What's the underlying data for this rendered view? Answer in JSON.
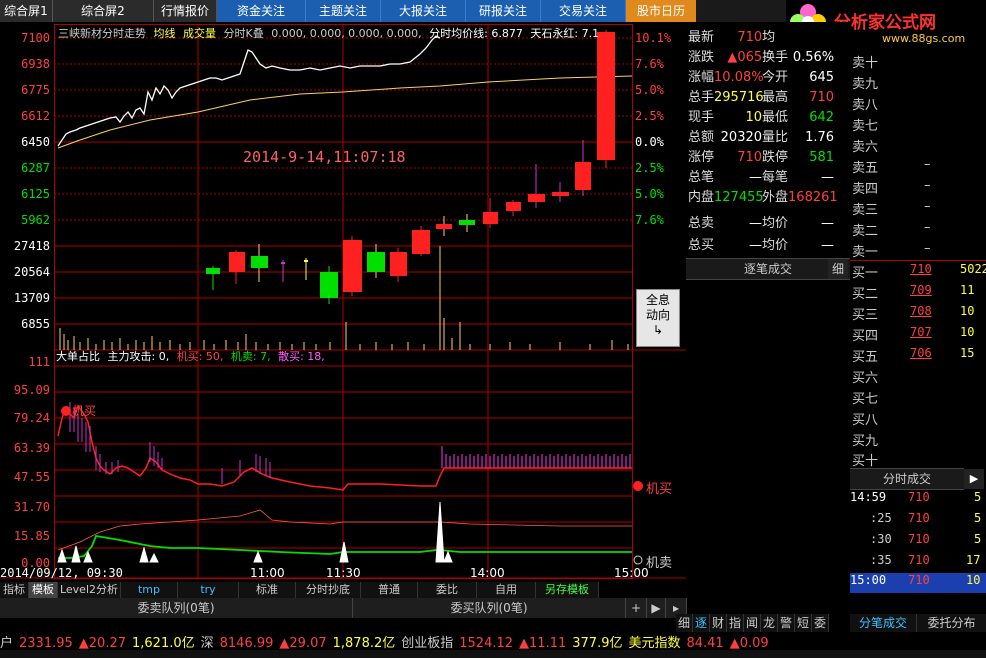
{
  "top_tabs": [
    {
      "label": "综合屏1",
      "style": "dark"
    },
    {
      "label": "综合屏2",
      "style": "dark"
    },
    {
      "label": "行情报价",
      "style": "dark"
    },
    {
      "label": "资金关注",
      "style": "blue"
    },
    {
      "label": "主题关注",
      "style": "blue"
    },
    {
      "label": "大报关注",
      "style": "blue"
    },
    {
      "label": "研报关注",
      "style": "blue"
    },
    {
      "label": "交易关注",
      "style": "blue"
    },
    {
      "label": "股市日历",
      "style": "orange"
    }
  ],
  "logo": {
    "text": "分析家公式网",
    "url_text": "www.88gs.com"
  },
  "chart_header": {
    "title": "三峡新材分时走势",
    "items": [
      "均线",
      "成交量",
      "分时K叠",
      "0.000, 0.000, 0.000, 0.000,",
      "分时均价线: 6.877",
      "天石永红: 7.1"
    ]
  },
  "date_stamp": "2014-9-14,11:07:18",
  "info_button": {
    "line1": "全息",
    "line2": "动向"
  },
  "lower_header": {
    "title": "大单占比",
    "main_attack": "主力攻击: 0,",
    "inst_buy": "机买: 50,",
    "inst_sell": "机卖: 7,",
    "retail_sell": "散买: 18,"
  },
  "lower_markers": {
    "buy_label": "机买",
    "sell_label": "机卖",
    "top_label": "机买"
  },
  "price_axis_left": [
    "7100",
    "6938",
    "6775",
    "6612",
    "6450",
    "6287",
    "6125",
    "5962"
  ],
  "pct_axis_right": [
    "10.1%",
    "7.6%",
    "5.0%",
    "2.5%",
    "0.0%",
    "2.5%",
    "5.0%",
    "7.6%"
  ],
  "volume_axis": [
    "27418",
    "20564",
    "13709",
    "6855"
  ],
  "lower_axis": [
    "111",
    "95.09",
    "79.24",
    "63.39",
    "47.55",
    "31.70",
    "15.85",
    "0.00"
  ],
  "time_axis": {
    "date": "2014/09/12, 09:30",
    "t1": "11:00",
    "t2": "11:30",
    "t3": "14:00",
    "t4": "15:00"
  },
  "quote": {
    "rows": [
      {
        "l": "最新",
        "v1": "710",
        "l2": "均",
        "v2": "",
        "c1": "qred",
        "c2": "qred"
      },
      {
        "l": "涨跌",
        "v1": "▲065",
        "l2": "换手",
        "v2": "0.56%",
        "c1": "qred",
        "c2": "qwht"
      },
      {
        "l": "涨幅",
        "v1": "10.08%",
        "l2": "今开",
        "v2": "645",
        "c1": "qred",
        "c2": "qwht"
      },
      {
        "l": "总手",
        "v1": "295716",
        "l2": "最高",
        "v2": "710",
        "c1": "qyel",
        "c2": "qred"
      },
      {
        "l": "现手",
        "v1": "10",
        "l2": "最低",
        "v2": "642",
        "c1": "qyel",
        "c2": "qgrn"
      },
      {
        "l": "总额",
        "v1": "20320",
        "l2": "量比",
        "v2": "1.76",
        "c1": "qwht",
        "c2": "qwht"
      },
      {
        "l": "涨停",
        "v1": "710",
        "l2": "跌停",
        "v2": "581",
        "c1": "qred",
        "c2": "qgrn"
      },
      {
        "l": "总笔",
        "v1": "—",
        "l2": "每笔",
        "v2": "—",
        "c1": "qwht",
        "c2": "qwht"
      },
      {
        "l": "内盘",
        "v1": "127455",
        "l2": "外盘",
        "v2": "168261",
        "c1": "qgrn",
        "c2": "qred"
      },
      {
        "l": "总卖",
        "v1": "—",
        "l2": "均价",
        "v2": "—",
        "c1": "qwht",
        "c2": "qwht"
      },
      {
        "l": "总买",
        "v1": "—",
        "l2": "均价",
        "v2": "—",
        "c1": "qwht",
        "c2": "qwht"
      }
    ]
  },
  "order_book": {
    "asks": [
      "卖十",
      "卖九",
      "卖八",
      "卖七",
      "卖六",
      "卖五",
      "卖四",
      "卖三",
      "卖二",
      "卖一"
    ],
    "ask_dash": "–",
    "bids": [
      {
        "l": "买一",
        "p": "710",
        "v": "5022"
      },
      {
        "l": "买二",
        "p": "709",
        "v": "11"
      },
      {
        "l": "买三",
        "p": "708",
        "v": "10"
      },
      {
        "l": "买四",
        "p": "707",
        "v": "10"
      },
      {
        "l": "买五",
        "p": "706",
        "v": "15"
      },
      {
        "l": "买六",
        "p": "",
        "v": ""
      },
      {
        "l": "买七",
        "p": "",
        "v": ""
      },
      {
        "l": "买八",
        "p": "",
        "v": ""
      },
      {
        "l": "买九",
        "p": "",
        "v": ""
      },
      {
        "l": "买十",
        "p": "",
        "v": ""
      }
    ]
  },
  "tick_panel": {
    "head": "逐笔成交",
    "head_btn": "细",
    "time_head": "分时成交",
    "rows": [
      {
        "t": "14:59",
        "p": "710",
        "v": "5"
      },
      {
        "t": ":25",
        "p": "710",
        "v": "5"
      },
      {
        "t": ":30",
        "p": "710",
        "v": "5"
      },
      {
        "t": ":35",
        "p": "710",
        "v": "17"
      },
      {
        "t": ":40",
        "p": "710",
        "v": "5"
      },
      {
        "t": "15:00",
        "p": "710",
        "v": "10"
      }
    ]
  },
  "bottom_tabs": [
    "指标",
    "模板",
    "Level2分析",
    "tmp",
    "try",
    "标准",
    "分时抄底",
    "普通",
    "委比",
    "自用",
    "另存模板"
  ],
  "queue_bar": {
    "sell": "委卖队列(0笔)",
    "buy": "委买队列(0笔)",
    "plus": "+"
  },
  "side_tabs": [
    "细",
    "逐",
    "财",
    "指",
    "闻",
    "龙",
    "警",
    "短",
    "委"
  ],
  "side_bottom": [
    "分笔成交",
    "委托分布"
  ],
  "ticker": [
    {
      "t": "户",
      "c": "#ccc"
    },
    {
      "t": "2331.95",
      "c": "#ff4040"
    },
    {
      "t": "▲20.27",
      "c": "#ff4040"
    },
    {
      "t": "1,621.0亿",
      "c": "#ffff40"
    },
    {
      "t": "深",
      "c": "#ccc"
    },
    {
      "t": "8146.99",
      "c": "#ff4040"
    },
    {
      "t": "▲29.07",
      "c": "#ff4040"
    },
    {
      "t": "1,878.2亿",
      "c": "#ffff40"
    },
    {
      "t": "创业板指",
      "c": "#ccc"
    },
    {
      "t": "1524.12",
      "c": "#ff4040"
    },
    {
      "t": "▲11.11",
      "c": "#ff4040"
    },
    {
      "t": "377.9亿",
      "c": "#ffff40"
    },
    {
      "t": "美元指数",
      "c": "#ffff40"
    },
    {
      "t": "84.41",
      "c": "#ff4040"
    },
    {
      "t": "▲0.09",
      "c": "#ff4040"
    }
  ],
  "colors": {
    "grid": "#b00000",
    "up": "#ff2020",
    "down": "#00e000",
    "price_line": "#ffffff",
    "avg_line": "#ffd060",
    "header_blue": "#1c5fb0"
  }
}
